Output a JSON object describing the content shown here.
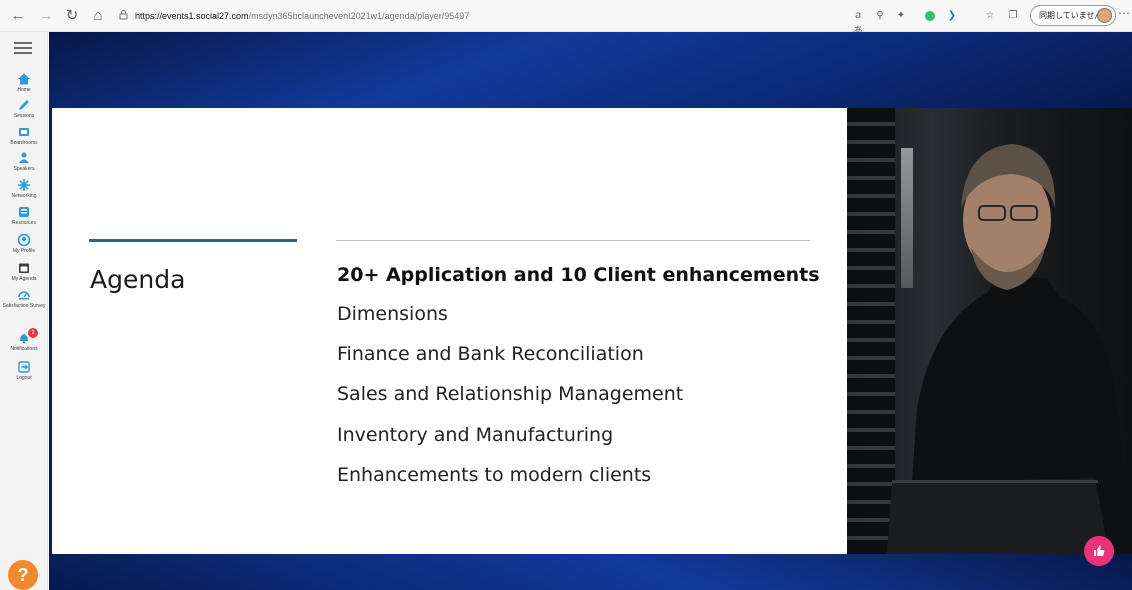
{
  "browser": {
    "url_host": "https://events1.social27.com",
    "url_path": "/msdyn365bclaunchevent2021w1/agenda/player/95497",
    "profile_label": "同期していません",
    "icons": [
      "back-icon",
      "forward-icon",
      "refresh-icon",
      "home-icon",
      "lock-icon",
      "read-aloud-icon",
      "zoom-icon",
      "extensions-icon",
      "green-extension-icon",
      "blue-extension-icon",
      "favorites-icon",
      "collections-icon",
      "more-icon"
    ]
  },
  "sidebar": {
    "items": [
      {
        "label": "Home",
        "icon": "home-icon",
        "color": "#2e9bd6"
      },
      {
        "label": "Sessions",
        "icon": "pencil-icon",
        "color": "#2e9bd6"
      },
      {
        "label": "Boardrooms",
        "icon": "boardroom-icon",
        "color": "#2e9bd6"
      },
      {
        "label": "Speakers",
        "icon": "speaker-icon",
        "color": "#2e9bd6"
      },
      {
        "label": "Networking",
        "icon": "networking-icon",
        "color": "#2e9bd6"
      },
      {
        "label": "Resources",
        "icon": "resources-icon",
        "color": "#2e9bd6"
      },
      {
        "label": "My Profile",
        "icon": "profile-icon",
        "color": "#2e9bd6"
      },
      {
        "label": "My Agenda",
        "icon": "calendar-icon",
        "color": "#3a3a3a"
      },
      {
        "label": "Satisfaction Survey",
        "icon": "survey-icon",
        "color": "#2e9bd6"
      },
      {
        "label": "Notifications",
        "icon": "bell-icon",
        "color": "#2e9bd6",
        "badge": "1"
      },
      {
        "label": "Logout",
        "icon": "logout-icon",
        "color": "#2e9bd6"
      }
    ],
    "help_label": "?"
  },
  "slide": {
    "title": "Agenda",
    "heading": "20+ Application and 10 Client enhancements",
    "items": [
      "Dimensions",
      "Finance and Bank Reconciliation",
      "Sales and Relationship Management",
      "Inventory and Manufacturing",
      "Enhancements to modern clients"
    ]
  },
  "colors": {
    "accent_blue": "#0d2f87",
    "rule": "#2f5f8a",
    "help": "#f08a2c",
    "like": "#e8337a",
    "badge": "#e03b3b"
  }
}
